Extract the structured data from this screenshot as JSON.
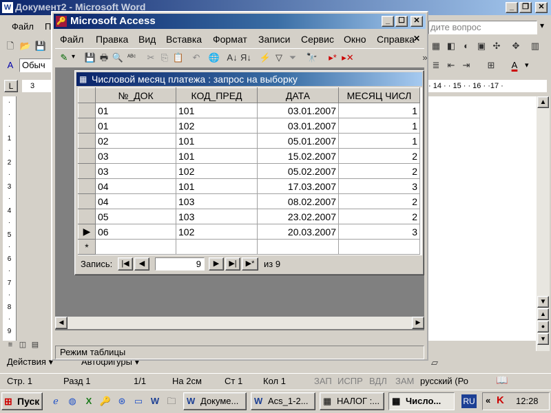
{
  "word": {
    "title": "Документ2 - Microsoft Word",
    "menu": [
      "Файл",
      "П"
    ],
    "style_box": "Обыч",
    "ask_placeholder": "дите вопрос",
    "ruler_right": "· 14 · · 15 · · 16 · ·17 ·",
    "ruler_left": "3",
    "draw_bar": {
      "actions": "Действия ▾",
      "autoshapes": "Автофигуры ▾"
    },
    "status": {
      "page": "Стр. 1",
      "section": "Разд 1",
      "pages": "1/1",
      "at": "На 2см",
      "line": "Ст 1",
      "col": "Кол 1",
      "rec": "ЗАП",
      "trk": "ИСПР",
      "ext": "ВДЛ",
      "ovr": "ЗАМ",
      "lang": "русский (Ро"
    }
  },
  "access": {
    "title": "Microsoft Access",
    "menu": [
      "Файл",
      "Правка",
      "Вид",
      "Вставка",
      "Формат",
      "Записи",
      "Сервис",
      "Окно",
      "Справка"
    ],
    "status": "Режим таблицы"
  },
  "query": {
    "title": "Числовой месяц платежа : запрос на выборку",
    "columns": [
      "№_ДОК",
      "КОД_ПРЕД",
      "ДАТА",
      "МЕСЯЦ ЧИСЛ"
    ],
    "rows": [
      [
        "01",
        "101",
        "03.01.2007",
        "1"
      ],
      [
        "01",
        "102",
        "03.01.2007",
        "1"
      ],
      [
        "02",
        "101",
        "05.01.2007",
        "1"
      ],
      [
        "03",
        "101",
        "15.02.2007",
        "2"
      ],
      [
        "03",
        "102",
        "05.02.2007",
        "2"
      ],
      [
        "04",
        "101",
        "17.03.2007",
        "3"
      ],
      [
        "04",
        "103",
        "08.02.2007",
        "2"
      ],
      [
        "05",
        "103",
        "23.02.2007",
        "2"
      ],
      [
        "06",
        "102",
        "20.03.2007",
        "3"
      ]
    ],
    "current_row_marker": "▶",
    "new_row_marker": "*",
    "nav": {
      "label": "Запись:",
      "current": "9",
      "of_label": "из 9"
    }
  },
  "taskbar": {
    "start": "Пуск",
    "buttons": [
      "Докуме...",
      "Acs_1-2...",
      "НАЛОГ :...",
      "Число..."
    ],
    "lang": "RU",
    "clock": "12:28"
  }
}
